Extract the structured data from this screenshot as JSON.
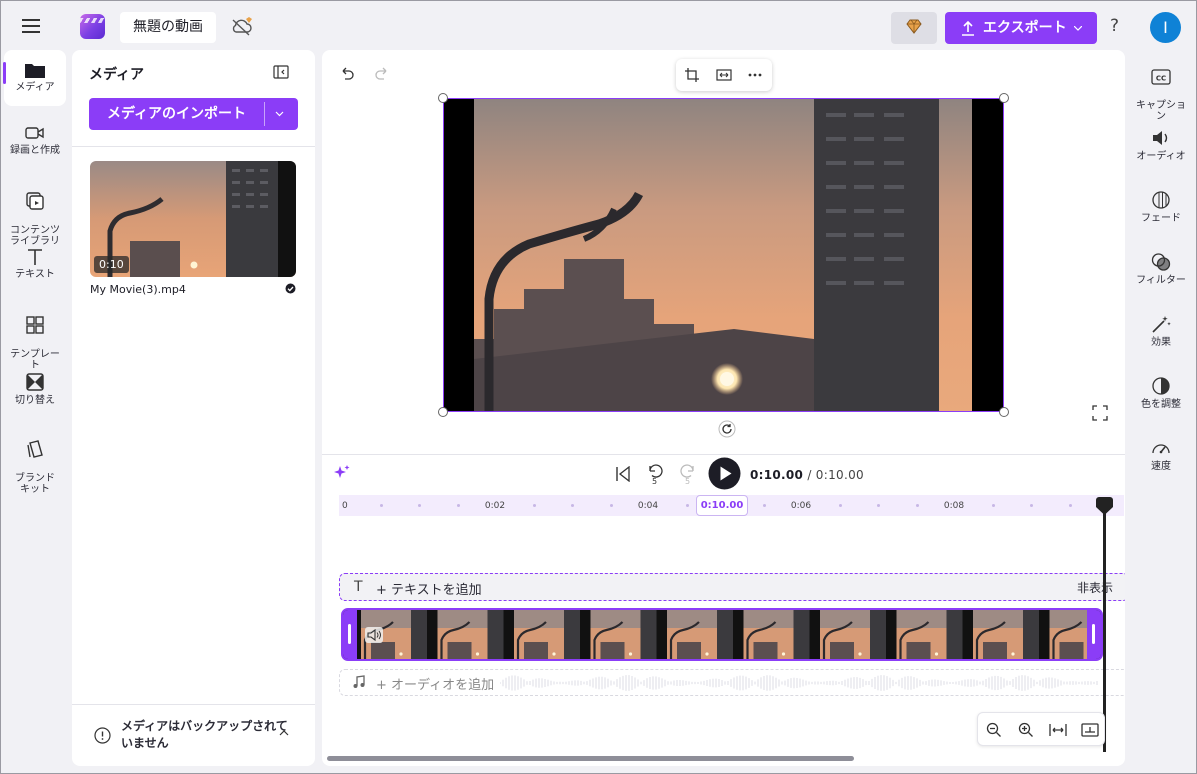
{
  "app": {
    "project_title": "無題の動画",
    "export_label": "エクスポート",
    "help_label": "?",
    "avatar_initial": "I",
    "accent": "#8b3df7"
  },
  "left_rail": [
    {
      "label": "メディア",
      "icon": "folder-icon",
      "active": true
    },
    {
      "label": "録画と作成",
      "icon": "camera-icon"
    },
    {
      "label": "コンテンツ\nライブラリ",
      "icon": "library-icon"
    },
    {
      "label": "テキスト",
      "icon": "text-icon"
    },
    {
      "label": "テンプレー\nト",
      "icon": "templates-icon"
    },
    {
      "label": "切り替え",
      "icon": "transition-icon"
    },
    {
      "label": "ブランド\nキット",
      "icon": "brand-kit-icon"
    }
  ],
  "media_panel": {
    "title": "メディア",
    "import_label": "メディアのインポート",
    "item": {
      "file_name": "My Movie(3).mp4",
      "duration": "0:10"
    },
    "backup_notice": "メディアはバックアップされていません"
  },
  "timeline": {
    "current_time": "0:10.00",
    "total_time": "/ 0:10.00",
    "skip_back_label": "5",
    "skip_fwd_label": "5",
    "ruler_labels": [
      "0",
      "0:02",
      "0:04",
      "0:06",
      "0:08"
    ],
    "playhead_badge": "0:10.00",
    "text_track_label": "+ テキストを追加",
    "text_track_hide": "非表示",
    "audio_track_label": "+ オーディオを追加"
  },
  "right_rail": [
    {
      "label": "キャプショ\nン",
      "icon": "captions-icon"
    },
    {
      "label": "オーディオ",
      "icon": "audio-icon"
    },
    {
      "label": "フェード",
      "icon": "fade-icon"
    },
    {
      "label": "フィルター",
      "icon": "filter-icon"
    },
    {
      "label": "効果",
      "icon": "effects-icon"
    },
    {
      "label": "色を調整",
      "icon": "color-adjust-icon"
    },
    {
      "label": "速度",
      "icon": "speed-icon"
    }
  ]
}
